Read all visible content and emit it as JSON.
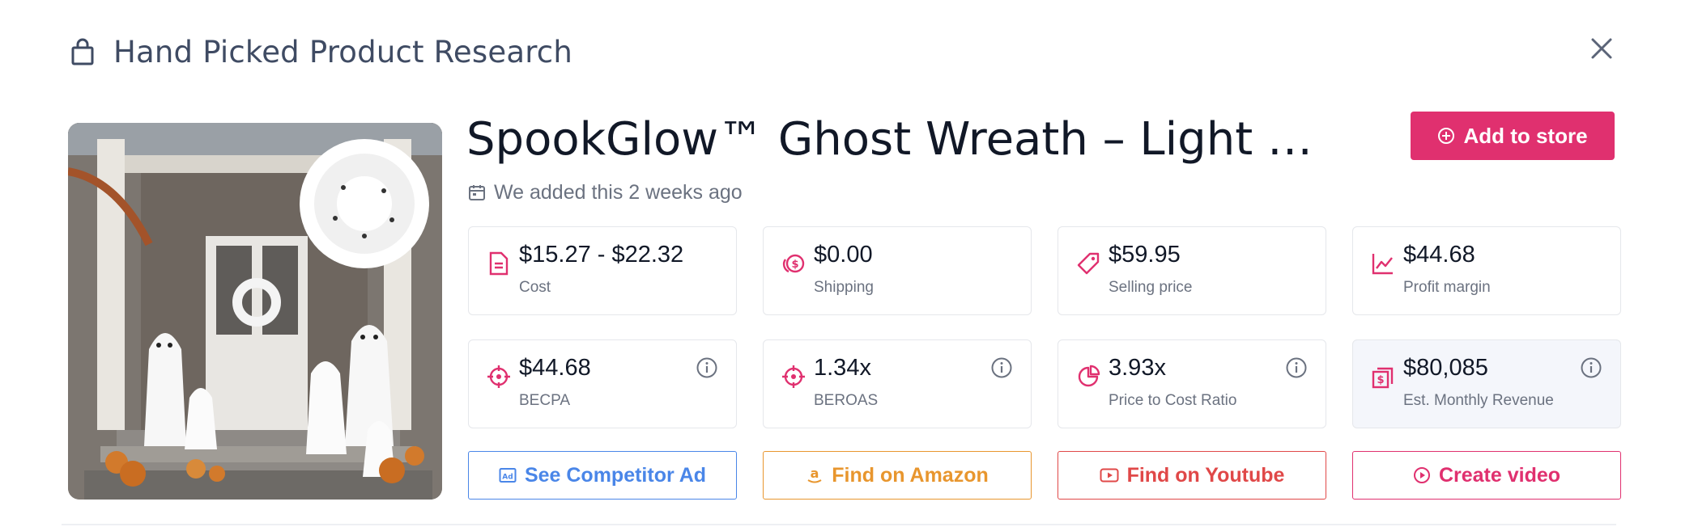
{
  "header": {
    "title": "Hand Picked Product Research",
    "icon": "shopping-bag-icon"
  },
  "product": {
    "title": "SpookGlow™ Ghost Wreath – Light Up…",
    "added_text": "We added this 2 weeks ago",
    "add_button_label": "Add to store"
  },
  "metrics": [
    {
      "value": "$15.27 - $22.32",
      "label": "Cost",
      "icon": "document-icon"
    },
    {
      "value": "$0.00",
      "label": "Shipping",
      "icon": "coins-icon"
    },
    {
      "value": "$59.95",
      "label": "Selling price",
      "icon": "price-tag-icon"
    },
    {
      "value": "$44.68",
      "label": "Profit margin",
      "icon": "trend-chart-icon"
    },
    {
      "value": "$44.68",
      "label": "BECPA",
      "icon": "crosshair-icon"
    },
    {
      "value": "1.34x",
      "label": "BEROAS",
      "icon": "crosshair-icon"
    },
    {
      "value": "3.93x",
      "label": "Price to Cost Ratio",
      "icon": "pie-chart-icon"
    },
    {
      "value": "$80,085",
      "label": "Est. Monthly Revenue",
      "icon": "cash-icon"
    }
  ],
  "actions": {
    "competitor_ad": "See Competitor Ad",
    "amazon": "Find on Amazon",
    "youtube": "Find on Youtube",
    "video": "Create video"
  },
  "colors": {
    "accent": "#e0306f",
    "competitor": "#4a86e8",
    "amazon": "#e8962e",
    "youtube": "#e04848",
    "video": "#e0306f"
  }
}
